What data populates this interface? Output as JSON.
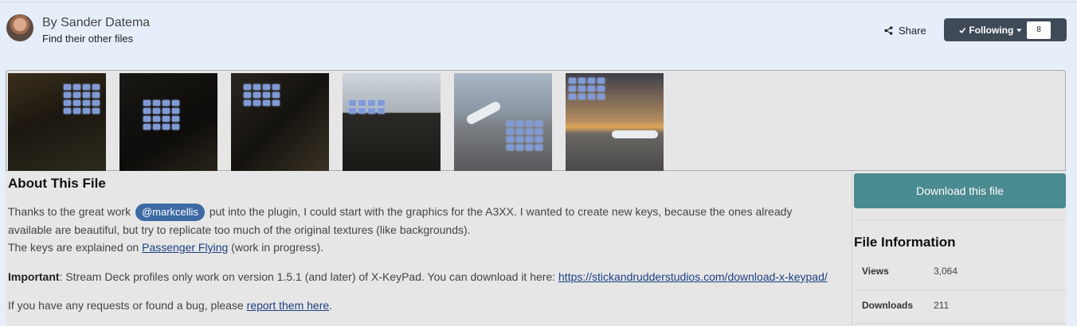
{
  "author": {
    "name": "By Sander Datema",
    "other_files_link": "Find their other files"
  },
  "actions": {
    "share_label": "Share",
    "following_label": "Following",
    "following_count": "8"
  },
  "gallery": {
    "thumbnails": [
      "thumbnail-1",
      "thumbnail-2",
      "thumbnail-3",
      "thumbnail-4",
      "thumbnail-5",
      "thumbnail-6"
    ]
  },
  "about": {
    "title": "About This File",
    "p1_before": "Thanks to the great work ",
    "mention": "@markcellis",
    "p1_after": " put into the plugin, I could start with the graphics for the A3XX. I wanted to create new keys, because the ones already",
    "p2": "available are beautiful, but try to replicate too much of the original textures (like backgrounds).",
    "p3_before": "The keys are explained on ",
    "p3_link": "Passenger Flying",
    "p3_after": " (work in progress).",
    "important_label": "Important",
    "important_text": ": Stream Deck profiles only work on version 1.5.1 (and later) of X-KeyPad. You can download it here: ",
    "important_link": "https://stickandrudderstudios.com/download-x-keypad/",
    "p5_before": "If you have any requests or found a bug, please ",
    "p5_link": "report them here",
    "p5_after": "."
  },
  "sidebar": {
    "download_label": "Download this file",
    "file_info_title": "File Information",
    "rows": [
      {
        "label": "Views",
        "value": "3,064"
      },
      {
        "label": "Downloads",
        "value": "211"
      }
    ]
  },
  "colors": {
    "page_bg": "#e6eef9",
    "follow_button": "#3f4a58",
    "download_button": "#4a8a91",
    "mention_pill": "#3d6aa3",
    "link": "#1d3f82"
  },
  "icons": {
    "share": "share-icon",
    "check": "check-icon",
    "caret": "caret-down-icon"
  }
}
